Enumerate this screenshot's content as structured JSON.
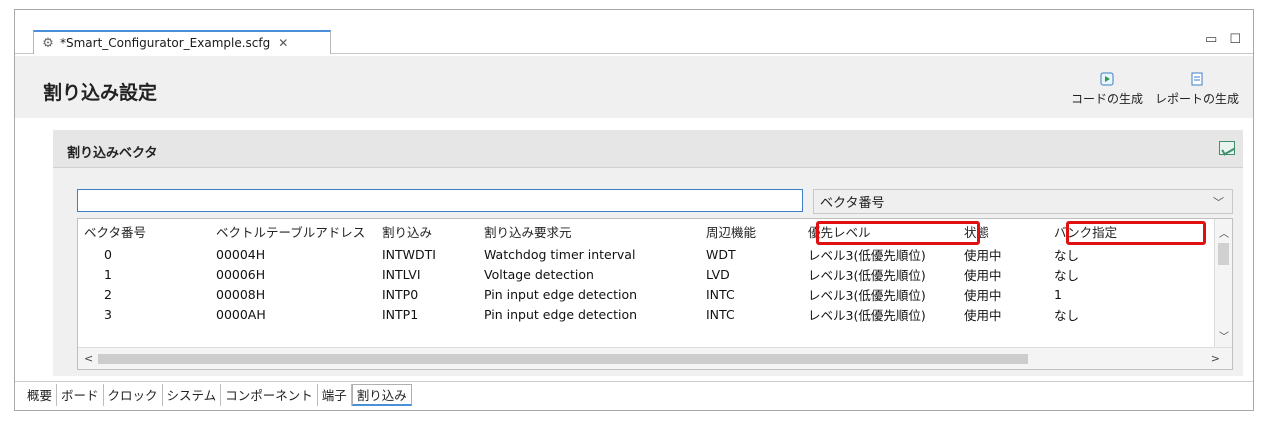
{
  "editor_tab": {
    "title": "*Smart_Configurator_Example.scfg",
    "close": "✕",
    "icon": "gear-icon"
  },
  "window_controls": {
    "minimize": "▭",
    "maximize": "☐"
  },
  "header": {
    "title": "割り込み設定",
    "actions": [
      {
        "label": "コードの生成",
        "icon": "generate-code-icon"
      },
      {
        "label": "レポートの生成",
        "icon": "generate-report-icon"
      }
    ]
  },
  "section": {
    "title": "割り込みベクタ",
    "icon": "chart-icon",
    "filter": {
      "value": "",
      "placeholder": ""
    },
    "select": {
      "value": "ベクタ番号",
      "chevron": "﹀"
    }
  },
  "table": {
    "columns": [
      "ベクタ番号",
      "ベクトルテーブルアドレス",
      "割り込み",
      "割り込み要求元",
      "周辺機能",
      "優先レベル",
      "状態",
      "バンク指定"
    ],
    "rows": [
      [
        "0",
        "00004H",
        "INTWDTI",
        "Watchdog timer interval",
        "WDT",
        "レベル3(低優先順位)",
        "使用中",
        "なし"
      ],
      [
        "1",
        "00006H",
        "INTLVI",
        "Voltage detection",
        "LVD",
        "レベル3(低優先順位)",
        "使用中",
        "なし"
      ],
      [
        "2",
        "00008H",
        "INTP0",
        "Pin input edge detection",
        "INTC",
        "レベル3(低優先順位)",
        "使用中",
        "1"
      ],
      [
        "3",
        "0000AH",
        "INTP1",
        "Pin input edge detection",
        "INTC",
        "レベル3(低優先順位)",
        "使用中",
        "なし"
      ]
    ],
    "highlight_color": "#e01010"
  },
  "scrollbars": {
    "up": "︿",
    "down": "﹀",
    "left": "<",
    "right": ">"
  },
  "bottom_tabs": [
    "概要",
    "ボード",
    "クロック",
    "システム",
    "コンポーネント",
    "端子",
    "割り込み"
  ],
  "active_bottom_tab": "割り込み",
  "colors": {
    "accent": "#4a90d9",
    "header_bg": "#f0f0f0"
  }
}
